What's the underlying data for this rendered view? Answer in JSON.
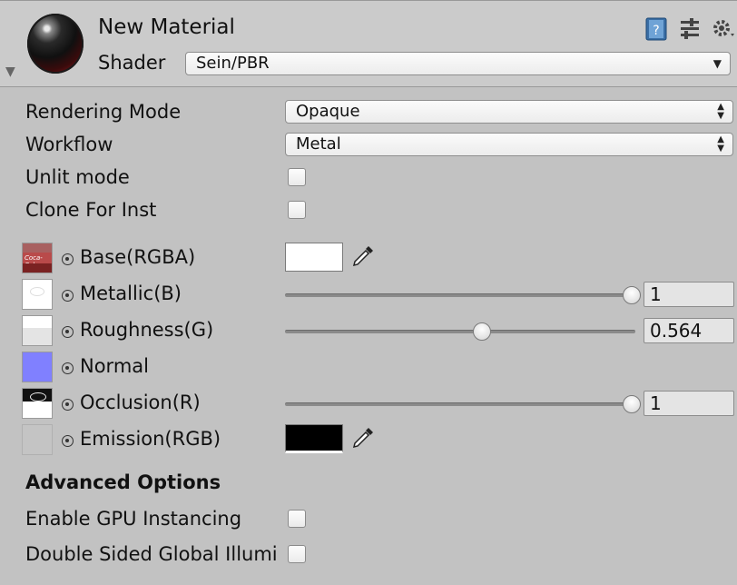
{
  "header": {
    "title": "New Material",
    "shader_label": "Shader",
    "shader_value": "Sein/PBR",
    "icons": [
      "help-book-icon",
      "preset-sliders-icon",
      "settings-gear-icon"
    ]
  },
  "options": {
    "rendering_mode_label": "Rendering Mode",
    "rendering_mode_value": "Opaque",
    "workflow_label": "Workflow",
    "workflow_value": "Metal",
    "unlit_label": "Unlit mode",
    "unlit_checked": false,
    "clone_label": "Clone For Inst",
    "clone_checked": false
  },
  "properties": {
    "base": {
      "label": "Base(RGBA)",
      "color": "#ffffff"
    },
    "metallic": {
      "label": "Metallic(B)",
      "value": "1",
      "slider_fraction": 1.0
    },
    "roughness": {
      "label": "Roughness(G)",
      "value": "0.564",
      "slider_fraction": 0.564
    },
    "normal": {
      "label": "Normal",
      "color": "#8080ff"
    },
    "occlusion": {
      "label": "Occlusion(R)",
      "value": "1",
      "slider_fraction": 1.0
    },
    "emission": {
      "label": "Emission(RGB)",
      "color": "#000000"
    }
  },
  "advanced": {
    "heading": "Advanced Options",
    "gpu_instancing_label": "Enable GPU Instancing",
    "gpu_instancing_checked": false,
    "double_sided_label": "Double Sided Global Illumi",
    "double_sided_checked": false
  },
  "thumbnail_texts": {
    "base": "Coca-Cola"
  }
}
